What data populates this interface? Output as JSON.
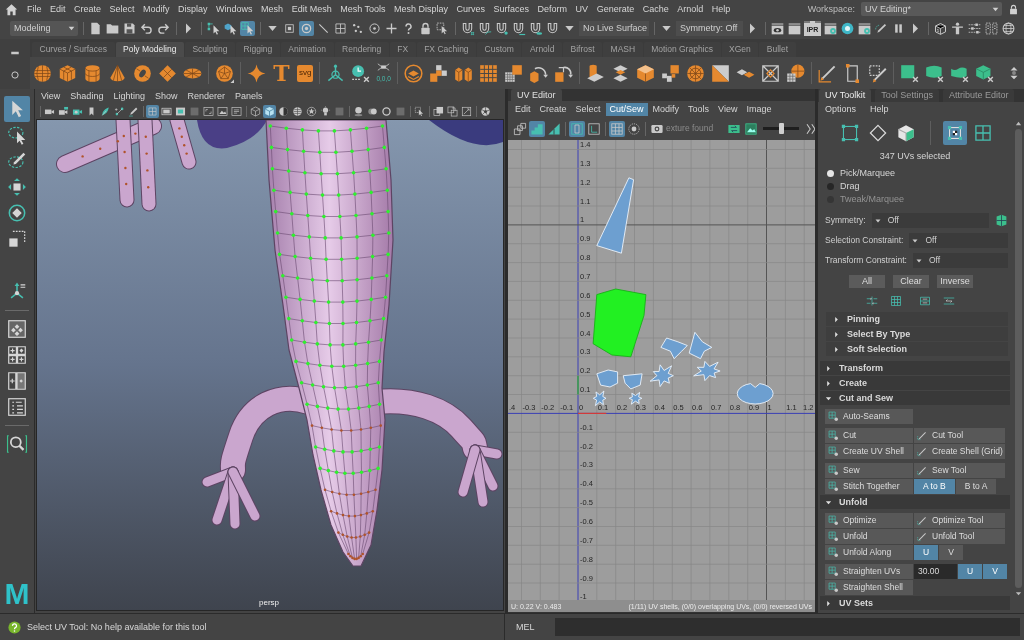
{
  "menu_bar": {
    "items": [
      "File",
      "Edit",
      "Create",
      "Select",
      "Modify",
      "Display",
      "Windows",
      "Mesh",
      "Edit Mesh",
      "Mesh Tools",
      "Mesh Display",
      "Curves",
      "Surfaces",
      "Deform",
      "UV",
      "Generate",
      "Cache",
      "Arnold",
      "Help"
    ],
    "workspace_label": "Workspace:",
    "workspace": "UV Editing*"
  },
  "status_line": {
    "menu_set": "Modeling",
    "live_surface": "No Live Surface",
    "symmetry": "Symmetry: Off",
    "ipr_label": "IPR",
    "tools": [
      {
        "selected": false
      },
      {
        "selected": false
      },
      {
        "selected": false
      },
      {
        "selected": false
      },
      {
        "selected": false
      },
      {
        "selected": false
      },
      {
        "selected": false
      },
      {
        "selected": false
      },
      {
        "selected": true
      },
      {
        "selected": false
      },
      {
        "selected": false
      },
      {
        "selected": true
      },
      {
        "selected": false
      },
      {
        "selected": false
      },
      {
        "selected": false
      },
      {
        "selected": false
      },
      {
        "selected": false
      },
      {
        "selected": false
      },
      {
        "selected": false
      },
      {
        "selected": false
      },
      {
        "selected": false
      },
      {
        "selected": false
      },
      {
        "selected": false
      },
      {
        "selected": false
      },
      {
        "selected": false
      },
      {
        "selected": false
      },
      {
        "selected": false
      },
      {
        "selected": false
      },
      {
        "selected": false
      },
      {
        "selected": false
      },
      {
        "selected": false
      },
      {
        "selected": false
      },
      {
        "selected": false
      },
      {
        "selected": false
      },
      {
        "selected": false
      },
      {
        "selected": false
      },
      {
        "selected": false
      },
      {
        "selected": false
      },
      {
        "selected": false
      },
      {
        "selected": false
      },
      {
        "selected": false
      },
      {
        "selected": false
      },
      {
        "selected": false
      }
    ]
  },
  "shelf": {
    "tabs": [
      {
        "label": "Curves / Surfaces",
        "selected": false
      },
      {
        "label": "Poly Modeling",
        "selected": true
      },
      {
        "label": "Sculpting",
        "selected": false
      },
      {
        "label": "Rigging",
        "selected": false
      },
      {
        "label": "Animation",
        "selected": false
      },
      {
        "label": "Rendering",
        "selected": false
      },
      {
        "label": "FX",
        "selected": false
      },
      {
        "label": "FX Caching",
        "selected": false
      },
      {
        "label": "Custom",
        "selected": false
      },
      {
        "label": "Arnold",
        "selected": false
      },
      {
        "label": "Bifrost",
        "selected": false
      },
      {
        "label": "MASH",
        "selected": false
      },
      {
        "label": "Motion Graphics",
        "selected": false
      },
      {
        "label": "XGen",
        "selected": false
      },
      {
        "label": "Bullet",
        "selected": false
      }
    ],
    "icon_labels": [
      "T",
      "svg",
      "0,0,0"
    ]
  },
  "toolbox": {
    "tools": [
      {
        "selected": true
      },
      {
        "selected": false
      },
      {
        "selected": false
      },
      {
        "selected": false
      },
      {
        "selected": false
      },
      {
        "selected": false
      },
      {
        "selected": false
      },
      {
        "selected": false
      },
      {
        "selected": false
      },
      {
        "selected": false
      },
      {
        "selected": false
      },
      {
        "selected": false
      }
    ],
    "logo": "M"
  },
  "viewport": {
    "menus": [
      "View",
      "Shading",
      "Lighting",
      "Show",
      "Renderer",
      "Panels"
    ],
    "tools": [
      {
        "selected": false
      },
      {
        "selected": false
      },
      {
        "selected": false
      },
      {
        "selected": false
      },
      {
        "selected": false
      },
      {
        "selected": false
      },
      {
        "selected": false
      },
      {
        "selected": true
      },
      {
        "selected": false
      },
      {
        "selected": false
      },
      {
        "selected": false
      },
      {
        "selected": false
      },
      {
        "selected": false
      },
      {
        "selected": false
      },
      {
        "selected": false
      },
      {
        "selected": true
      },
      {
        "selected": false
      },
      {
        "selected": false
      },
      {
        "selected": false
      },
      {
        "selected": false
      },
      {
        "selected": false
      },
      {
        "selected": false
      },
      {
        "selected": false
      },
      {
        "selected": false
      },
      {
        "selected": false
      },
      {
        "selected": false
      },
      {
        "selected": false
      },
      {
        "selected": false
      },
      {
        "selected": false
      },
      {
        "selected": false
      }
    ],
    "camera": "persp"
  },
  "uv_editor": {
    "title": "UV Editor",
    "menus": [
      {
        "label": "Edit",
        "selected": false
      },
      {
        "label": "Create",
        "selected": false
      },
      {
        "label": "Select",
        "selected": false
      },
      {
        "label": "Cut/Sew",
        "selected": true
      },
      {
        "label": "Modify",
        "selected": false
      },
      {
        "label": "Tools",
        "selected": false
      },
      {
        "label": "View",
        "selected": false
      },
      {
        "label": "Image",
        "selected": false
      }
    ],
    "tools": [
      {
        "selected": false
      },
      {
        "selected": true
      },
      {
        "selected": false
      },
      {
        "selected": true
      },
      {
        "selected": false
      },
      {
        "selected": true
      },
      {
        "selected": false
      },
      {
        "selected": false
      },
      {
        "selected": false
      },
      {
        "selected": false
      },
      {
        "selected": false
      }
    ],
    "texture_status": "exture found",
    "zoom_slider": {
      "level": 0.5
    },
    "u_ticks": [
      ".4",
      "-0.3",
      "-0.2",
      "-0.1",
      "0",
      "0.1",
      "0.2",
      "0.3",
      "0.4",
      "0.5",
      "0.6",
      "0.7",
      "0.8",
      "0.9",
      "1",
      "1.1",
      "1.2"
    ],
    "v_ticks": [
      "1.4",
      "1.3",
      "1.2",
      "1.1",
      "1",
      "0.9",
      "0.8",
      "0.7",
      "0.6",
      "0.5",
      "0.4",
      "0.3",
      "0.2",
      "0.1",
      "-0.1",
      "-0.2",
      "-0.3",
      "-0.4",
      "-0.5",
      "-0.6",
      "-0.7",
      "-0.8",
      "-0.9",
      "-1"
    ],
    "shells": [
      {
        "selected": false
      },
      {
        "selected": true
      },
      {
        "selected": false
      },
      {
        "selected": false
      },
      {
        "selected": false
      },
      {
        "selected": false
      },
      {
        "selected": false
      },
      {
        "selected": false
      },
      {
        "selected": false
      },
      {
        "selected": false
      },
      {
        "selected": false
      }
    ],
    "cursor_readout": "U: 0.22 V: 0.483",
    "shell_info": "(1/11) UV shells, (0/0) overlapping UVs, (0/0) reversed UVs"
  },
  "uv_toolkit": {
    "tabs": [
      {
        "label": "UV Toolkit",
        "selected": true
      },
      {
        "label": "Tool Settings",
        "selected": false
      },
      {
        "label": "Attribute Editor",
        "selected": false
      }
    ],
    "menus": [
      "Options",
      "Help"
    ],
    "modes": [
      {
        "selected": false
      },
      {
        "selected": false
      },
      {
        "selected": false
      },
      {
        "selected": true
      },
      {
        "selected": false
      }
    ],
    "selection_count": "347 UVs selected",
    "tool_modes": [
      {
        "label": "Pick/Marquee",
        "selected": true,
        "disabled": false
      },
      {
        "label": "Drag",
        "selected": false,
        "disabled": false
      },
      {
        "label": "Tweak/Marquee",
        "selected": false,
        "disabled": true
      }
    ],
    "options": [
      {
        "label": "Symmetry:",
        "value": "Off"
      },
      {
        "label": "Selection Constraint:",
        "value": "Off"
      },
      {
        "label": "Transform Constraint:",
        "value": "Off"
      }
    ],
    "selection_buttons": [
      "All",
      "Clear",
      "Inverse"
    ],
    "sections": [
      {
        "kind": "subsection",
        "title": "Pinning",
        "expanded": false
      },
      {
        "kind": "subsection",
        "title": "Select By Type",
        "expanded": false
      },
      {
        "kind": "subsection",
        "title": "Soft Selection",
        "expanded": false
      },
      {
        "kind": "section",
        "title": "Transform",
        "expanded": false
      },
      {
        "kind": "section",
        "title": "Create",
        "expanded": false
      },
      {
        "kind": "section",
        "title": "Cut and Sew",
        "expanded": true,
        "groups": [
          {
            "rows": [
              {
                "items": [
                  {
                    "kind": "command",
                    "label": "Auto-Seams"
                  }
                ]
              }
            ]
          },
          {
            "rows": [
              {
                "items": [
                  {
                    "kind": "command",
                    "label": "Cut"
                  },
                  {
                    "kind": "command",
                    "label": "Cut Tool"
                  }
                ]
              },
              {
                "items": [
                  {
                    "kind": "command",
                    "label": "Create UV Shell"
                  },
                  {
                    "kind": "command",
                    "label": "Create Shell (Grid)"
                  }
                ]
              }
            ]
          },
          {
            "rows": [
              {
                "items": [
                  {
                    "kind": "command",
                    "label": "Sew"
                  },
                  {
                    "kind": "command",
                    "label": "Sew Tool"
                  }
                ]
              },
              {
                "items": [
                  {
                    "kind": "command",
                    "label": "Stitch Together"
                  },
                  {
                    "kind": "toggle",
                    "label": "A to B",
                    "selected": true
                  },
                  {
                    "kind": "toggle",
                    "label": "B to A",
                    "selected": false
                  }
                ]
              }
            ]
          }
        ]
      },
      {
        "kind": "section",
        "title": "Unfold",
        "expanded": true,
        "groups": [
          {
            "rows": [
              {
                "items": [
                  {
                    "kind": "command",
                    "label": "Optimize"
                  },
                  {
                    "kind": "command",
                    "label": "Optimize Tool"
                  }
                ]
              },
              {
                "items": [
                  {
                    "kind": "command",
                    "label": "Unfold"
                  },
                  {
                    "kind": "command",
                    "label": "Unfold Tool"
                  }
                ]
              },
              {
                "items": [
                  {
                    "kind": "command",
                    "label": "Unfold Along"
                  },
                  {
                    "kind": "toggle",
                    "label": "U",
                    "selected": true
                  },
                  {
                    "kind": "toggle",
                    "label": "V",
                    "selected": false
                  }
                ]
              }
            ]
          },
          {
            "rows": [
              {
                "items": [
                  {
                    "kind": "command",
                    "label": "Straighten UVs"
                  },
                  {
                    "kind": "number",
                    "value": "30.00"
                  },
                  {
                    "kind": "toggle",
                    "label": "U",
                    "selected": true
                  },
                  {
                    "kind": "toggle",
                    "label": "V",
                    "selected": true
                  }
                ]
              },
              {
                "items": [
                  {
                    "kind": "command",
                    "label": "Straighten Shell"
                  }
                ]
              }
            ]
          }
        ]
      },
      {
        "kind": "section",
        "title": "UV Sets",
        "expanded": false
      }
    ]
  },
  "help_line": {
    "text": "Select UV Tool: No help available for this tool",
    "language": "MEL"
  }
}
